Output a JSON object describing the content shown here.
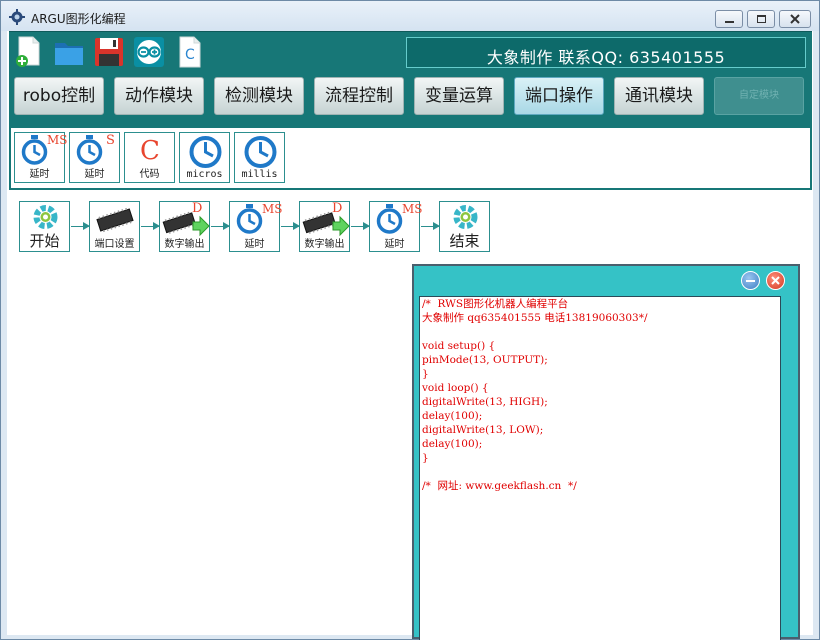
{
  "window": {
    "title": "ARGU图形化编程"
  },
  "toolbar": {
    "icons": [
      {
        "name": "new-file-icon"
      },
      {
        "name": "open-folder-icon"
      },
      {
        "name": "save-icon"
      },
      {
        "name": "arduino-icon"
      },
      {
        "name": "c-file-icon",
        "text": "C"
      }
    ],
    "contact": "大象制作  联系QQ: 635401555"
  },
  "categories": [
    {
      "label": "robo控制"
    },
    {
      "label": "动作模块"
    },
    {
      "label": "检测模块"
    },
    {
      "label": "流程控制"
    },
    {
      "label": "变量运算"
    },
    {
      "label": "端口操作",
      "active": true
    },
    {
      "label": "通讯模块"
    },
    {
      "label": "自定模块",
      "disabled": true
    }
  ],
  "palette": [
    {
      "label": "延时",
      "badge": "MS",
      "icon": "timer-icon"
    },
    {
      "label": "延时",
      "badge": "S",
      "icon": "timer-icon"
    },
    {
      "label": "代码",
      "badge": "C",
      "icon": "code-icon"
    },
    {
      "label": "micros",
      "icon": "clock-icon"
    },
    {
      "label": "millis",
      "icon": "clock-icon"
    }
  ],
  "flow": [
    {
      "label": "开始",
      "icon": "gear-start-icon"
    },
    {
      "label": "端口设置",
      "icon": "chip-icon"
    },
    {
      "label": "数字输出",
      "badge": "D",
      "icon": "chip-output-icon"
    },
    {
      "label": "延时",
      "badge": "MS",
      "icon": "timer-icon"
    },
    {
      "label": "数字输出",
      "badge": "D",
      "icon": "chip-output-icon"
    },
    {
      "label": "延时",
      "badge": "MS",
      "icon": "timer-icon"
    },
    {
      "label": "结束",
      "icon": "gear-end-icon"
    }
  ],
  "code": {
    "lines": [
      "/*  RWS图形化机器人编程平台",
      "大象制作 qq635401555 电话13819060303*/",
      "",
      "void setup() {",
      "pinMode(13, OUTPUT);",
      "}",
      "void loop() {",
      "digitalWrite(13, HIGH);",
      "delay(100);",
      "digitalWrite(13, LOW);",
      "delay(100);",
      "}",
      "",
      "/*  网址: www.geekflash.cn  */"
    ]
  },
  "colors": {
    "teal_dark": "#177777",
    "teal_panel": "#35c2c6",
    "code_text": "#e00000"
  }
}
